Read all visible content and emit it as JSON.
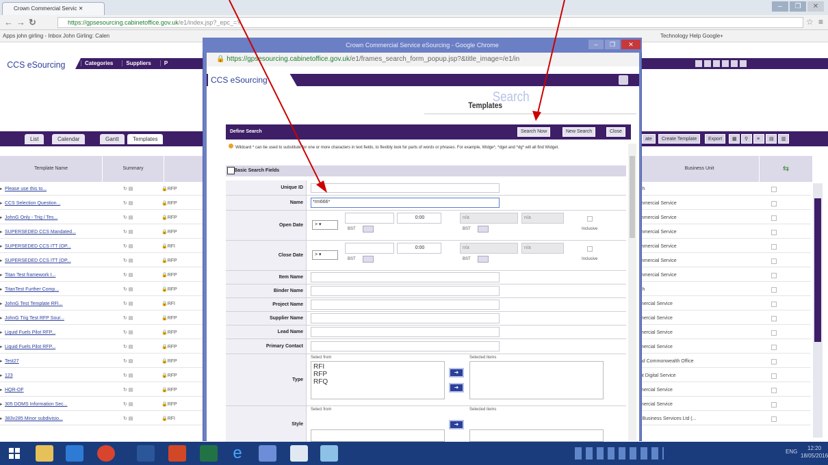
{
  "browser": {
    "tab_title": "Crown Commercial Servic",
    "url_host": "https://gpsesourcing.cabinetoffice.gov.uk",
    "url_path": "/e1/index.jsp?_epc_=Y",
    "bookmarks": "Apps   john girling - Inbox   John Girling: Calen",
    "bookmarks_right": "Technology Help   Google+"
  },
  "app": {
    "brand": "CCS eSourcing",
    "top_menu": [
      "Categories",
      "Suppliers",
      "P"
    ],
    "view_tabs": [
      "List",
      "Calendar",
      "Gantt",
      "Templates"
    ],
    "right_buttons": [
      "ate",
      "Create Template",
      "Export"
    ],
    "columns": [
      "Template Name",
      "Summary",
      "Business Unit"
    ],
    "rows": [
      {
        "name": "Please use this to...",
        "type": "RFP",
        "bu": "ch"
      },
      {
        "name": "CCS Selection Question...",
        "type": "RFP",
        "bu": "mmercial Service"
      },
      {
        "name": "JohnG Only - Trig / Tes...",
        "type": "RFP",
        "bu": "mmercial Service"
      },
      {
        "name": "SUPERSEDED CCS  Mandated...",
        "type": "RFP",
        "bu": "mmercial Service"
      },
      {
        "name": "SUPERSEDED CCS ITT (OP...",
        "type": "RFI",
        "bu": "mmercial Service"
      },
      {
        "name": "SUPERSEDED CCS ITT (OP...",
        "type": "RFP",
        "bu": "mmercial Service"
      },
      {
        "name": "Titan Test framework I...",
        "type": "RFP",
        "bu": "mmercial Service"
      },
      {
        "name": "TitanTest Further Comp...",
        "type": "RFP",
        "bu": "ch"
      },
      {
        "name": "JohnG Test Template RFI...",
        "type": "RFI",
        "bu": "mercial Service"
      },
      {
        "name": "JohnG Trig Test RFP Sour...",
        "type": "RFP",
        "bu": "mercial Service"
      },
      {
        "name": "Liquid Fuels Pilot RFP...",
        "type": "RFP",
        "bu": "mercial Service"
      },
      {
        "name": "Liquid Fuels Pilot RFP...",
        "type": "RFP",
        "bu": "mercial Service"
      },
      {
        "name": "Test27",
        "type": "RFP",
        "bu": "ad Commonwealth Office"
      },
      {
        "name": "123",
        "type": "RFP",
        "bu": "nt Digital Service"
      },
      {
        "name": "HQR-OF",
        "type": "RFP",
        "bu": "mercial Service"
      },
      {
        "name": "305 DOMS Information Sec...",
        "type": "RFP",
        "bu": "mercial Service"
      },
      {
        "name": "383v285 Minor subdivisio...",
        "type": "RFI",
        "bu": "l Business Services Ltd (..."
      }
    ]
  },
  "popup": {
    "title": "Crown Commercial Service eSourcing - Google Chrome",
    "url_host": "https://gpsesourcing.cabinetoffice.gov.uk",
    "url_path": "/e1/frames_search_form_popup.jsp?&title_image=/e1/in",
    "brand": "CCS eSourcing",
    "search_word": "Search",
    "templates_word": "Templates",
    "define_search": "Define Search",
    "buttons": {
      "search_now": "Search Now",
      "new_search": "New Search",
      "close": "Close"
    },
    "wildcard_text": "Wildcard * can be used to substitute for one or more characters in text fields, to flexibly look for parts of words or phrases. For example, Widge*, *dget and *dg* will all find Widget.",
    "basic_fields": "Basic Search Fields",
    "labels": {
      "unique_id": "Unique ID",
      "name": "Name",
      "open_date": "Open Date",
      "close_date": "Close Date",
      "item_name": "Item Name",
      "binder_name": "Binder Name",
      "project_name": "Project Name",
      "supplier_name": "Supplier Name",
      "lead_name": "Lead Name",
      "primary_contact": "Primary Contact",
      "type": "Type",
      "style": "Style"
    },
    "name_value": "*rm666*",
    "operator": ">",
    "time": "0:00",
    "na": "n/a",
    "bst": "BST",
    "inclusive": "Inclusive",
    "select_from": "Select from",
    "selected_items": "Selected items",
    "type_options": [
      "RFI",
      "RFP",
      "RFQ"
    ]
  },
  "taskbar": {
    "lang": "ENG",
    "time": "12:20",
    "date": "18/05/2016"
  },
  "colors": {
    "purple": "#3d1e67",
    "popup_frame": "#6b7fc4",
    "taskbar": "#1a3c7c",
    "link": "#2b3f9b"
  }
}
